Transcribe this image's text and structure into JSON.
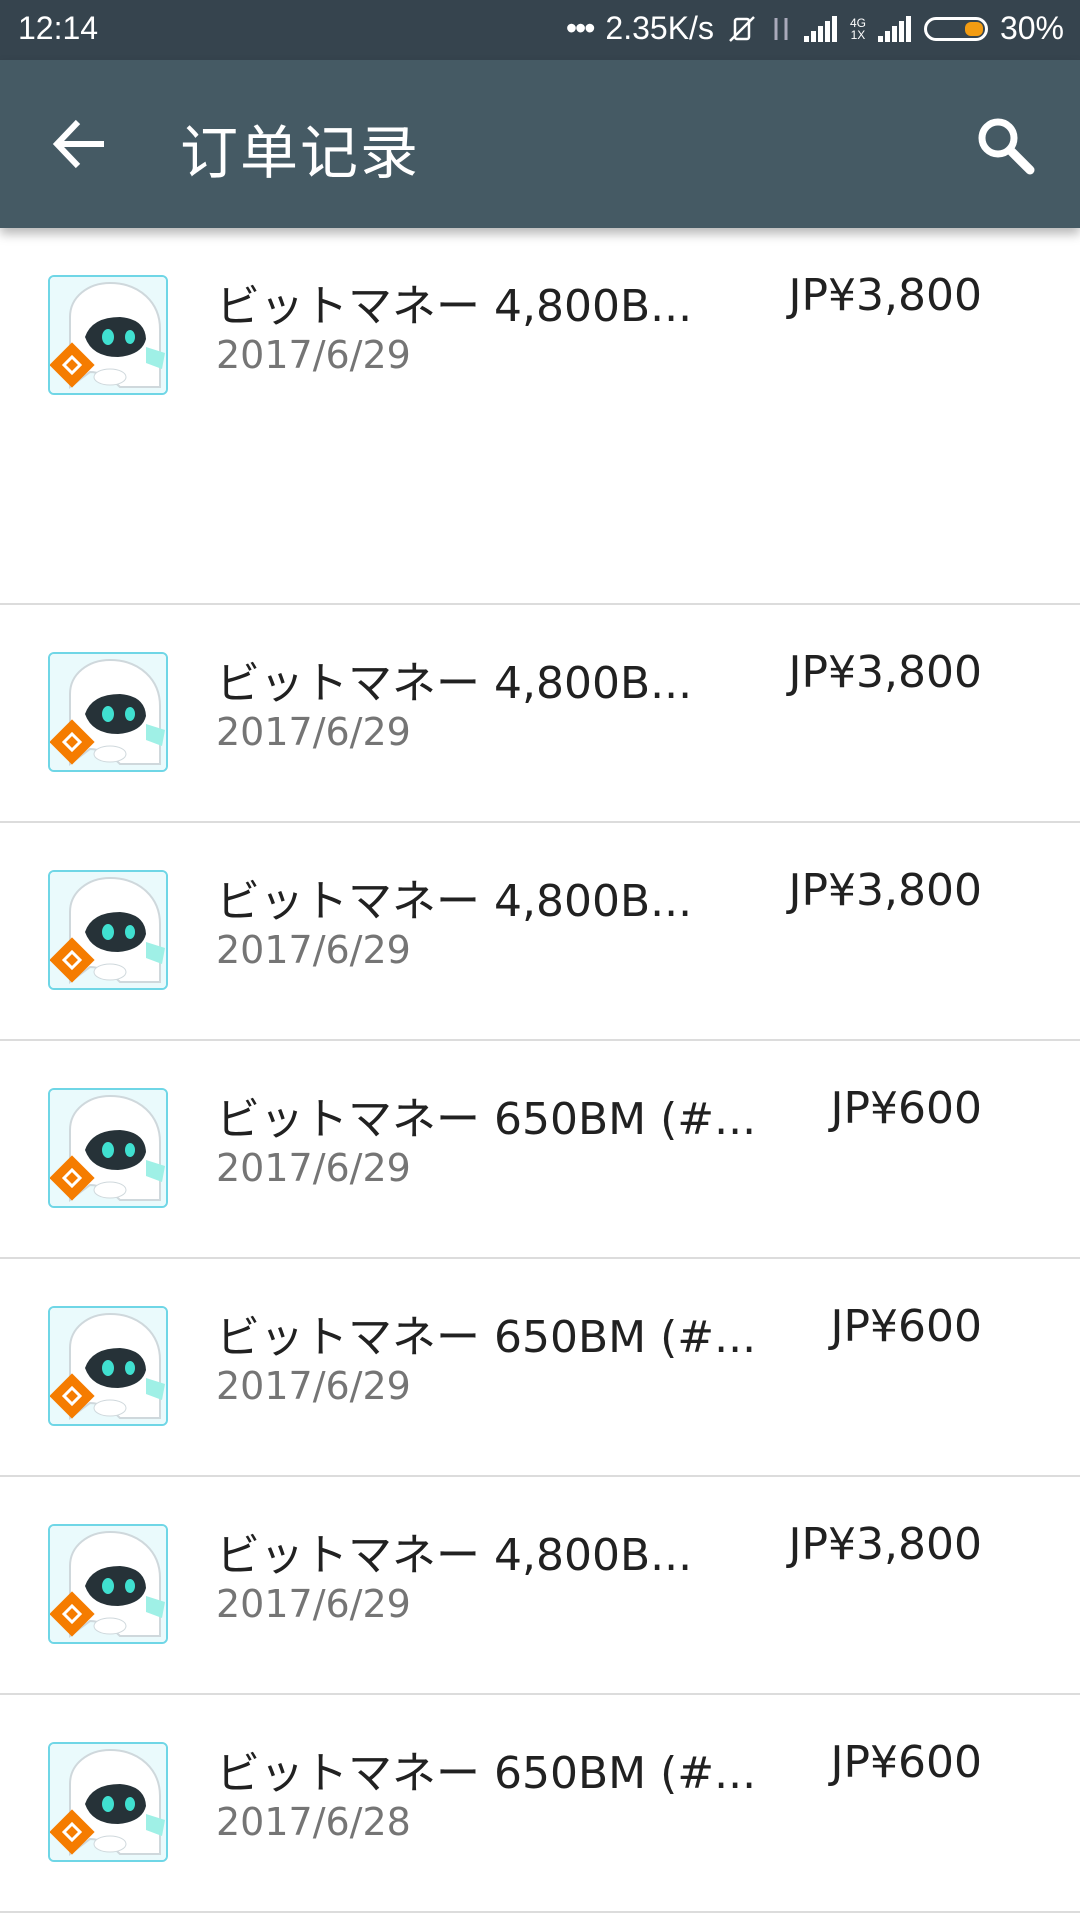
{
  "status_bar": {
    "time": "12:14",
    "dots": "•••",
    "speed": "2.35K/s",
    "net_label_top": "4G",
    "net_label_bottom": "1X",
    "battery": "30%"
  },
  "app_bar": {
    "title": "订单记录",
    "back_icon": "arrow-left-icon",
    "search_icon": "search-icon",
    "color": "#455a64"
  },
  "orders": [
    {
      "title": "ビットマネー 4,800B...",
      "date": "2017/6/29",
      "price": "JP¥3,800"
    },
    {
      "title": "ビットマネー 4,800B...",
      "date": "2017/6/29",
      "price": "JP¥3,800"
    },
    {
      "title": "ビットマネー 4,800B...",
      "date": "2017/6/29",
      "price": "JP¥3,800"
    },
    {
      "title": "ビットマネー 650BM (#...",
      "date": "2017/6/29",
      "price": "JP¥600"
    },
    {
      "title": "ビットマネー 650BM (#...",
      "date": "2017/6/29",
      "price": "JP¥600"
    },
    {
      "title": "ビットマネー 4,800B...",
      "date": "2017/6/29",
      "price": "JP¥3,800"
    },
    {
      "title": "ビットマネー 650BM (#...",
      "date": "2017/6/28",
      "price": "JP¥600"
    }
  ]
}
